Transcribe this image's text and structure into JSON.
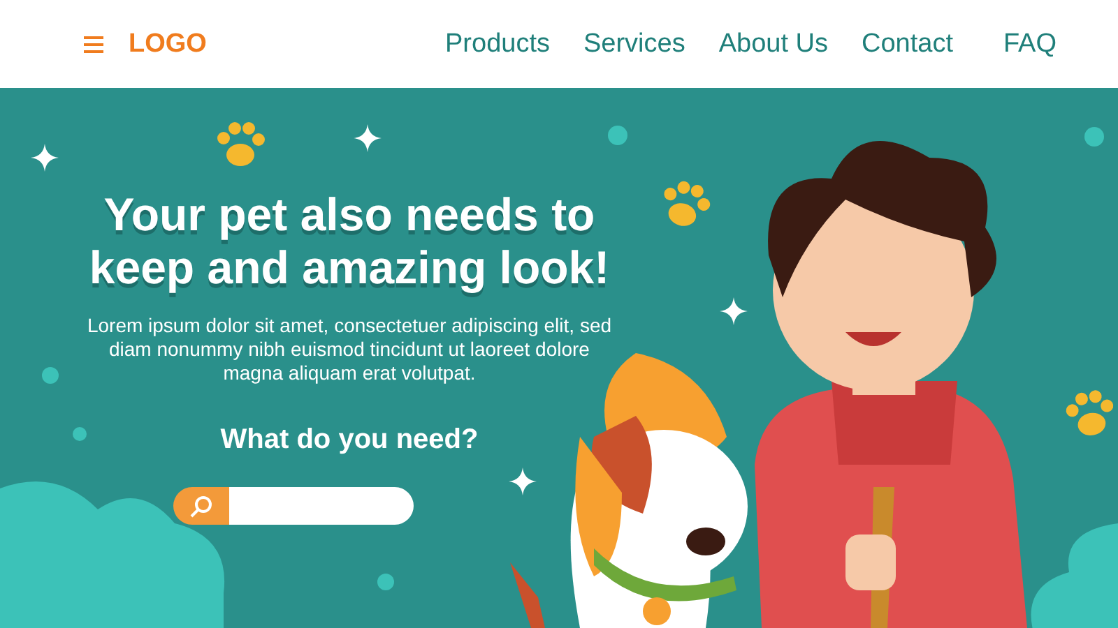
{
  "header": {
    "logo": "LOGO",
    "nav": [
      {
        "label": "Products"
      },
      {
        "label": "Services"
      },
      {
        "label": "About Us"
      },
      {
        "label": "Contact"
      },
      {
        "label": "FAQ"
      }
    ]
  },
  "hero": {
    "title": "Your pet also needs to keep and amazing look!",
    "description": "Lorem ipsum dolor sit amet, consectetuer adipiscing elit, sed diam nonummy nibh euismod tincidunt ut laoreet dolore magna aliquam erat volutpat.",
    "prompt": "What do you need?"
  }
}
